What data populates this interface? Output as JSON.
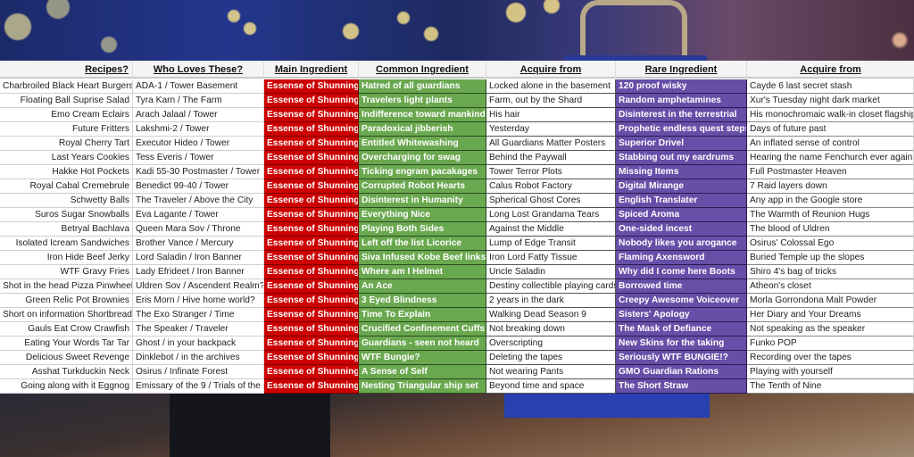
{
  "headers": [
    "Recipes?",
    "Who Loves These?",
    "Main Ingredient",
    "Common Ingredient",
    "Acquire from",
    "Rare Ingredient",
    "Acquire from"
  ],
  "colors": {
    "main_ingredient": "#cc0000",
    "common_ingredient": "#6aa84f",
    "rare_ingredient": "#674ea7"
  },
  "rows": [
    [
      "Charbroiled Black Heart Burgers",
      "ADA-1 / Tower Basement",
      "Essense of Shunning",
      "Hatred of all guardians",
      "Locked alone in the basement",
      "120 proof wisky",
      "Cayde 6 last secret stash"
    ],
    [
      "Floating Ball Suprise Salad",
      "Tyra Karn / The Farm",
      "Essense of Shunning",
      "Travelers light plants",
      "Farm, out by the Shard",
      "Random amphetamines",
      "Xur's Tuesday night dark market"
    ],
    [
      "Emo Cream Eclairs",
      "Arach Jalaal / Tower",
      "Essense of Shunning",
      "Indifference toward  mankind",
      "His hair",
      "Disinterest in the terrestrial",
      "His monochromaic walk-in closet flagship"
    ],
    [
      "Future Fritters",
      "Lakshmi-2 / Tower",
      "Essense of Shunning",
      "Paradoxical jibberish",
      "Yesterday",
      "Prophetic endless quest steps",
      "Days of future past"
    ],
    [
      "Royal Cherry Tart",
      "Executor Hideo / Tower",
      "Essense of Shunning",
      "Entitled Whitewashing",
      "All Guardians Matter Posters",
      "Superior Drivel",
      "An inflated sense of control"
    ],
    [
      "Last Years Cookies",
      "Tess Everis / Tower",
      "Essense of Shunning",
      "Overcharging for swag",
      "Behind the Paywall",
      "Stabbing out my eardrums",
      "Hearing the name Fenchurch ever again!"
    ],
    [
      "Hakke Hot Pockets",
      "Kadi 55-30 Postmaster / Tower",
      "Essense of Shunning",
      "Ticking engram pacakages",
      "Tower Terror Plots",
      "Missing Items",
      "Full Postmaster Heaven"
    ],
    [
      "Royal Cabal Cremebrule",
      "Benedict 99-40 / Tower",
      "Essense of Shunning",
      "Corrupted Robot Hearts",
      "Calus Robot Factory",
      "Digital Mirange",
      "7 Raid layers down"
    ],
    [
      "Schwetty Balls",
      "The Traveler / Above the City",
      "Essense of Shunning",
      "Disinterest in Humanity",
      "Spherical Ghost Cores",
      "English Translater",
      "Any app in the Google store"
    ],
    [
      "Suros Sugar Snowballs",
      "Eva Lagante / Tower",
      "Essense of Shunning",
      "Everything Nice",
      "Long Lost Grandama Tears",
      "Spiced Aroma",
      "The Warmth of Reunion Hugs"
    ],
    [
      "Betryal Bachlava",
      "Queen Mara Sov / Throne",
      "Essense of Shunning",
      "Playing Both Sides",
      "Against the Middle",
      "One-sided incest",
      "The blood of Uldren"
    ],
    [
      "Isolated Icream Sandwiches",
      "Brother Vance / Mercury",
      "Essense of Shunning",
      "Left off the list Licorice",
      "Lump of Edge Transit",
      "Nobody likes you arogance",
      "Osirus' Colossal Ego"
    ],
    [
      "Iron Hide Beef Jerky",
      "Lord Saladin / Iron Banner",
      "Essense of Shunning",
      "Siva Infused Kobe Beef links",
      "Iron Lord Fatty Tissue",
      "Flaming Axensword",
      "Buried Temple up the slopes"
    ],
    [
      "WTF Gravy Fries",
      "Lady Efrideet / Iron Banner",
      "Essense of Shunning",
      "Where am I Helmet",
      "Uncle Saladin",
      "Why did I come here Boots",
      "Shiro 4's bag of tricks"
    ],
    [
      "Shot in the head Pizza Pinwheels",
      "Uldren Sov / Ascendent Realm?",
      "Essense of Shunning",
      "An Ace",
      "Destiny collectible playing cards",
      "Borrowed time",
      "Atheon's closet"
    ],
    [
      "Green Relic Pot Brownies",
      "Eris Morn / Hive home world?",
      "Essense of Shunning",
      "3 Eyed Blindness",
      "2 years in the dark",
      "Creepy Awesome Voiceover",
      "Morla Gorrondona Malt Powder"
    ],
    [
      "Short on information Shortbread",
      "The Exo Stranger / Time",
      "Essense of Shunning",
      "Time To Explain",
      "Walking Dead Season 9",
      "Sisters' Apology",
      "Her Diary and Your Dreams"
    ],
    [
      "Gauls Eat Crow Crawfish",
      "The Speaker / Traveler",
      "Essense of Shunning",
      "Crucified Confinement Cuffs",
      "Not breaking down",
      "The Mask of Defiance",
      "Not speaking as the speaker"
    ],
    [
      "Eating Your Words Tar Tar",
      "Ghost / in your backpack",
      "Essense of Shunning",
      "Guardians - seen not heard",
      "Overscripting",
      "New Skins for the taking",
      "Funko POP"
    ],
    [
      "Delicious Sweet Revenge",
      "Dinklebot / in the archives",
      "Essense of Shunning",
      "WTF Bungie?",
      "Deleting the tapes",
      "Seriously WTF BUNGIE!?",
      "Recording over the tapes"
    ],
    [
      "Asshat Turkduckin Neck",
      "Osirus / Infinate Forest",
      "Essense of Shunning",
      "A Sense of Self",
      "Not wearing Pants",
      "GMO Guardian Rations",
      "Playing with yourself"
    ],
    [
      "Going along with it Eggnog",
      "Emissary of the 9 / Trials of the",
      "Essense of Shunning",
      "Nesting Triangular ship set",
      "Beyond time and space",
      "The Short Straw",
      "The Tenth of Nine"
    ]
  ]
}
